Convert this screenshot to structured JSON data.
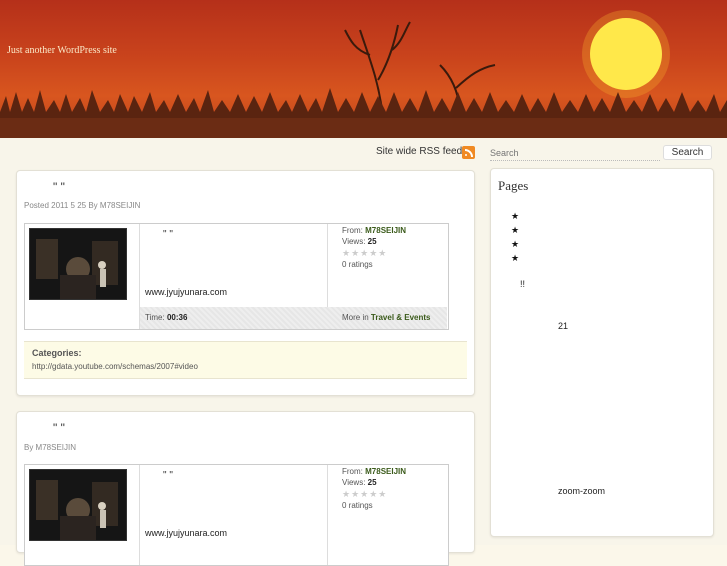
{
  "header": {
    "tagline": "Just another WordPress site"
  },
  "toolbar": {
    "rss_label": "Site wide RSS feed.",
    "search_placeholder": "Search",
    "search_button": "Search"
  },
  "posts": [
    {
      "title": "\"     \"",
      "meta": "Posted 2011 5 25  By M78SEIJIN",
      "video": {
        "title": "\"    \"",
        "url": "www.jyujyunara.com",
        "from_label": "From:",
        "from_user": "M78SEIJIN",
        "views_label": "Views:",
        "views": "25",
        "stars": "★★★★★",
        "ratings": "0 ratings",
        "time_label": "Time:",
        "time": "00:36",
        "more_label": "More in",
        "more_category": "Travel & Events"
      },
      "categories_label": "Categories:",
      "categories_value": "http://gdata.youtube.com/schemas/2007#video"
    },
    {
      "title": "\"     \"",
      "meta": "By M78SEIJIN",
      "video": {
        "title": "\"    \"",
        "url": "www.jyujyunara.com",
        "from_label": "From:",
        "from_user": "M78SEIJIN",
        "views_label": "Views:",
        "views": "25",
        "stars": "★★★★★",
        "ratings": "0 ratings"
      }
    }
  ],
  "sidebar": {
    "title": "Pages",
    "items": [
      "★",
      "★",
      "★",
      "★"
    ],
    "text1": "!!",
    "text2": "21",
    "text3": "zoom-zoom"
  },
  "colors": {
    "sky_top": "#b5301a",
    "sky_mid": "#d8561f",
    "sun": "#ffe84a",
    "link_green": "#3a5a1a",
    "rss_orange": "#f08a24"
  }
}
